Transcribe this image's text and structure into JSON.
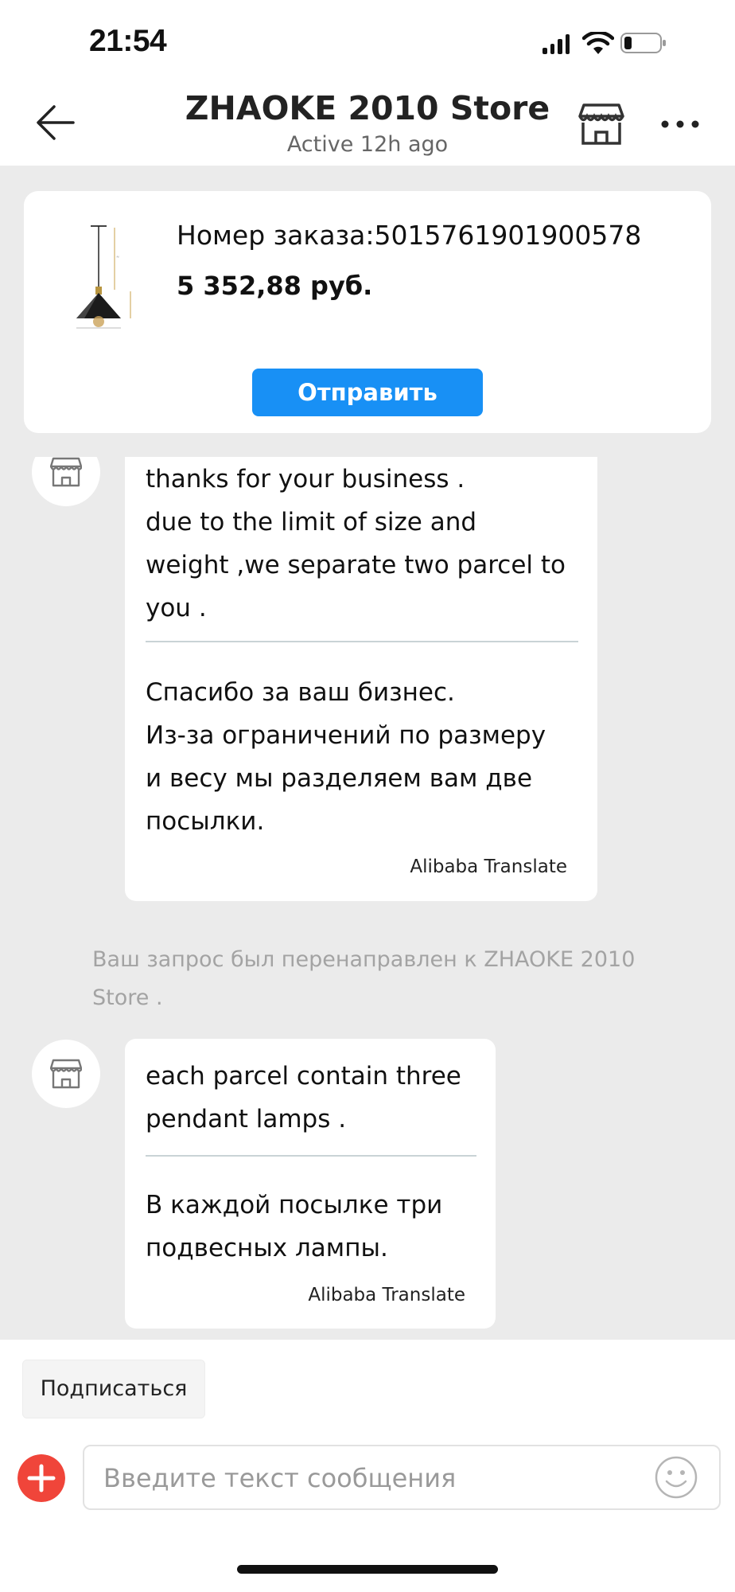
{
  "status_bar": {
    "time": "21:54"
  },
  "header": {
    "title": "ZHAOKE 2010 Store",
    "subtitle": "Active 12h ago"
  },
  "order": {
    "number_label": "Номер заказа:5015761901900578",
    "price": "5 352,88 руб.",
    "send_label": "Отправить"
  },
  "messages": [
    {
      "original": [
        "thanks for your business .",
        "due to the limit of size and",
        "weight ,we separate two parcel to",
        "you ."
      ],
      "translated": [
        "Спасибо за ваш бизнес.",
        "Из-за ограничений по размеру",
        "и весу мы разделяем вам две",
        "посылки."
      ],
      "translator": "Alibaba Translate"
    },
    {
      "original": [
        "each parcel contain three",
        "pendant lamps ."
      ],
      "translated": [
        "В каждой посылке три",
        "подвесных лампы."
      ],
      "translator": "Alibaba Translate"
    }
  ],
  "system_note": "Ваш запрос был перенаправлен к ZHAOKE 2010 Store .",
  "bottom": {
    "subscribe_label": "Подписаться",
    "input_placeholder": "Введите текст сообщения"
  },
  "colors": {
    "accent_blue": "#1890f5",
    "plus_red": "#f0453a",
    "chat_background": "#ebebeb"
  },
  "icons": [
    "back-arrow-icon",
    "store-icon",
    "more-icon",
    "shop-avatar-icon",
    "plus-icon",
    "emoji-icon",
    "signal-icon",
    "wifi-icon",
    "battery-icon"
  ]
}
